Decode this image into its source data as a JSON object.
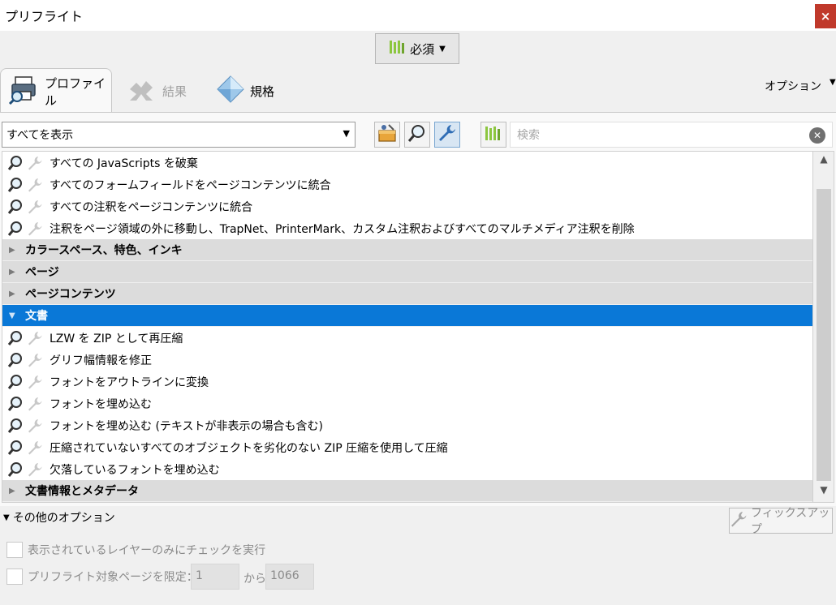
{
  "window": {
    "title": "プリフライト",
    "close_label": "×"
  },
  "mode": {
    "label": "必須"
  },
  "tabs": [
    {
      "label": "プロファイル"
    },
    {
      "label": "結果"
    },
    {
      "label": "規格"
    }
  ],
  "options_menu": {
    "label": "オプション"
  },
  "filter": {
    "selected": "すべてを表示"
  },
  "search": {
    "placeholder": "検索"
  },
  "rows": [
    {
      "kind": "item",
      "label": "すべての JavaScripts を破棄"
    },
    {
      "kind": "item",
      "label": "すべてのフォームフィールドをページコンテンツに統合"
    },
    {
      "kind": "item",
      "label": "すべての注釈をページコンテンツに統合"
    },
    {
      "kind": "item",
      "label": "注釈をページ領域の外に移動し、TrapNet、PrinterMark、カスタム注釈およびすべてのマルチメディア注釈を削除"
    },
    {
      "kind": "cat",
      "label": "カラースペース、特色、インキ",
      "expanded": false
    },
    {
      "kind": "cat",
      "label": "ページ",
      "expanded": false
    },
    {
      "kind": "cat",
      "label": "ページコンテンツ",
      "expanded": false
    },
    {
      "kind": "cat",
      "label": "文書",
      "expanded": true,
      "selected": true
    },
    {
      "kind": "item",
      "label": "LZW を ZIP として再圧縮"
    },
    {
      "kind": "item",
      "label": "グリフ幅情報を修正"
    },
    {
      "kind": "item",
      "label": "フォントをアウトラインに変換"
    },
    {
      "kind": "item",
      "label": "フォントを埋め込む"
    },
    {
      "kind": "item",
      "label": "フォントを埋め込む (テキストが非表示の場合も含む)"
    },
    {
      "kind": "item",
      "label": "圧縮されていないすべてのオブジェクトを劣化のない ZIP 圧縮を使用して圧縮"
    },
    {
      "kind": "item",
      "label": "欠落しているフォントを埋め込む"
    },
    {
      "kind": "cat",
      "label": "文書情報とメタデータ",
      "expanded": false
    }
  ],
  "more_options": {
    "label": "その他のオプション"
  },
  "fixup_button": {
    "label": "フィックスアップ"
  },
  "visible_layers_only": {
    "label": "表示されているレイヤーのみにチェックを実行",
    "checked": false
  },
  "limit_pages": {
    "label": "プリフライト対象ページを限定：",
    "checked": false,
    "from": "1",
    "to_label": "から",
    "to": "1066"
  },
  "colors": {
    "selection": "#0a78d7",
    "close": "#c0392b",
    "accent_green": "#8cc63f"
  }
}
